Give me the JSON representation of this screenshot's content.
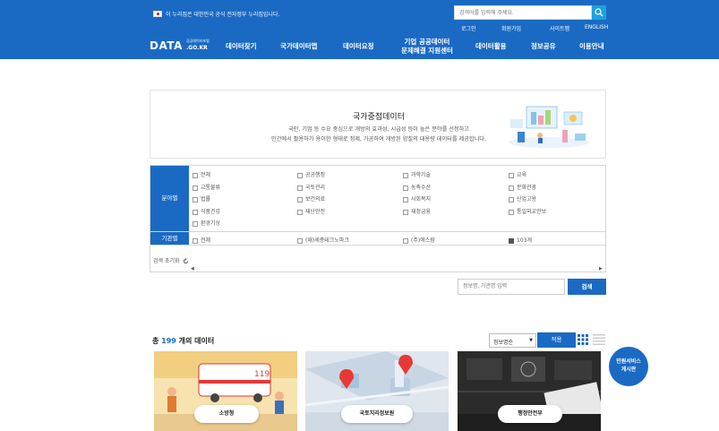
{
  "header": {
    "gov_notice": "이 누리집은 대한민국 공식 전자정부 누리집입니다.",
    "search_placeholder": "검색어를 입력해 주세요.",
    "util_links": [
      "로그인",
      "회원가입",
      "사이트맵",
      "ENGLISH"
    ],
    "logo_main": "DATA",
    "logo_sub": "공공데이터포털",
    "logo_kr": ".GO.KR",
    "nav": [
      "데이터찾기",
      "국가데이터맵",
      "데이터요청",
      "기업 공공데이터",
      "문제해결 지원센터",
      "데이터활용",
      "정보공유",
      "이용안내"
    ]
  },
  "intro": {
    "title": "국가중점데이터",
    "desc_line1": "국민, 기업 등 수요 중심으로 개방의 효과성, 시급성 등이 높은 분야를 선정하고",
    "desc_line2": "민간에서 활용하기 용이한 형태로 정제, 가공하여 개방된 양질의 대용량 데이터를 제공합니다."
  },
  "filter": {
    "field_label": "분야별",
    "field_items": [
      "전체",
      "공공행정",
      "과학기술",
      "교육",
      "교통물류",
      "국토관리",
      "농축수산",
      "문화관광",
      "법률",
      "보건의료",
      "사회복지",
      "산업고용",
      "식품건강",
      "재난안전",
      "재정금융",
      "통일외교안보",
      "환경기상"
    ],
    "org_label": "기관별",
    "org_items": [
      "전체",
      "(재)세종테크노파크",
      "(주)에스람",
      "103개"
    ],
    "reset_label": "검색 초기화"
  },
  "search": {
    "placeholder": "정보명, 기관명 입력",
    "button": "검색"
  },
  "results": {
    "prefix": "총",
    "count": "199",
    "suffix": "개의 데이터",
    "sort_value": "정보명순",
    "apply_label": "적용"
  },
  "cards": [
    {
      "org": "소방청"
    },
    {
      "org": "국토지리정보원"
    },
    {
      "org": "행정안전부"
    }
  ],
  "float_button": {
    "line1": "민원서비스",
    "line2": "게시판"
  },
  "colors": {
    "primary": "#1a6ac4",
    "accent": "#1ea1e0"
  }
}
